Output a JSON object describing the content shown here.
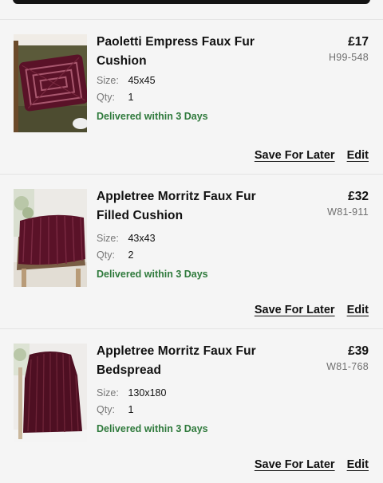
{
  "items": [
    {
      "name": "Paoletti Empress Faux Fur Cushion",
      "price": "£17",
      "sku": "H99-548",
      "size_label": "Size:",
      "size_value": "45x45",
      "qty_label": "Qty:",
      "qty_value": "1",
      "delivery": "Delivered within 3 Days",
      "save_label": "Save For Later",
      "edit_label": "Edit"
    },
    {
      "name": "Appletree Morritz Faux Fur Filled Cushion",
      "price": "£32",
      "sku": "W81-911",
      "size_label": "Size:",
      "size_value": "43x43",
      "qty_label": "Qty:",
      "qty_value": "2",
      "delivery": "Delivered within 3 Days",
      "save_label": "Save For Later",
      "edit_label": "Edit"
    },
    {
      "name": "Appletree Morritz Faux Fur Bedspread",
      "price": "£39",
      "sku": "W81-768",
      "size_label": "Size:",
      "size_value": "130x180",
      "qty_label": "Qty:",
      "qty_value": "1",
      "delivery": "Delivered within 3 Days",
      "save_label": "Save For Later",
      "edit_label": "Edit"
    }
  ],
  "colors": {
    "delivery_green": "#2f7a3c",
    "cushion_burgundy": "#5a1228",
    "chair_green": "#5b5a3a",
    "background": "#f5f5f5"
  }
}
